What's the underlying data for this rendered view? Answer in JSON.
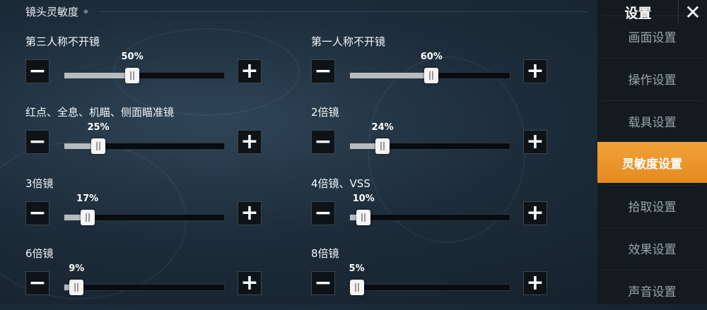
{
  "section_title": "镜头灵敏度",
  "controls": {
    "minus": "−",
    "plus": "+"
  },
  "settings": [
    {
      "label": "第三人称不开镜",
      "value": 50,
      "value_text": "50%"
    },
    {
      "label": "第一人称不开镜",
      "value": 60,
      "value_text": "60%"
    },
    {
      "label": "红点、全息、机瞄、侧面瞄准镜",
      "value": 25,
      "value_text": "25%"
    },
    {
      "label": "2倍镜",
      "value": 24,
      "value_text": "24%"
    },
    {
      "label": "3倍镜",
      "value": 17,
      "value_text": "17%"
    },
    {
      "label": "4倍镜、VSS",
      "value": 10,
      "value_text": "10%"
    },
    {
      "label": "6倍镜",
      "value": 9,
      "value_text": "9%"
    },
    {
      "label": "8倍镜",
      "value": 5,
      "value_text": "5%"
    }
  ],
  "sidebar": {
    "title": "设置",
    "close_icon": "close-icon",
    "items": [
      {
        "label": "画面设置",
        "active": false
      },
      {
        "label": "操作设置",
        "active": false
      },
      {
        "label": "载具设置",
        "active": false
      },
      {
        "label": "灵敏度设置",
        "active": true
      },
      {
        "label": "拾取设置",
        "active": false
      },
      {
        "label": "效果设置",
        "active": false
      },
      {
        "label": "声音设置",
        "active": false
      }
    ],
    "accent_color": "#ee9a2c"
  }
}
